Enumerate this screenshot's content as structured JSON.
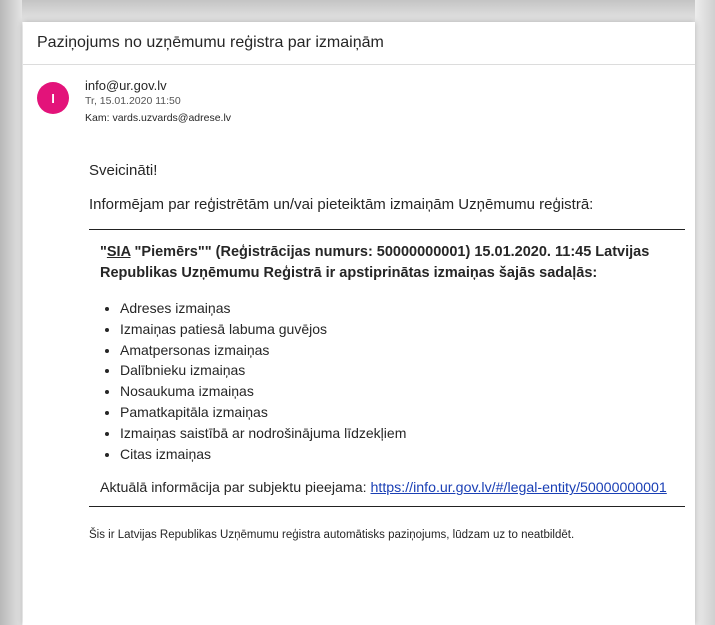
{
  "email": {
    "subject": "Paziņojums no uzņēmumu reģistra par izmaiņām",
    "avatar_initial": "I",
    "avatar_color": "#e3137a",
    "from": "info@ur.gov.lv",
    "date": "Tr, 15.01.2020 11:50",
    "to_label": "Kam:",
    "to": "vards.uzvards@adrese.lv",
    "greeting": "Sveicināti!",
    "intro": "Informējam par reģistrētām un/vai pieteiktām izmaiņām Uzņēmumu reģistrā:",
    "main_open_quote": "\"",
    "main_company_abbr": "SIA",
    "main_company_name": " \"Piemērs\"\"",
    "main_text_rest": " (Reģistrācijas numurs: 50000000001) 15.01.2020. 11:45 Latvijas Republikas Uzņēmumu Reģistrā ir apstiprinātas izmaiņas šajās sadaļās:",
    "changes": [
      "Adreses izmaiņas",
      "Izmaiņas patiesā labuma guvējos",
      "Amatpersonas izmaiņas",
      "Dalībnieku izmaiņas",
      "Nosaukuma izmaiņas",
      "Pamatkapitāla izmaiņas",
      "Izmaiņas saistībā ar nodrošinājuma līdzekļiem",
      "Citas izmaiņas"
    ],
    "info_text": "Aktuālā informācija par subjektu pieejama: ",
    "info_link": "https://info.ur.gov.lv/#/legal-entity/50000000001",
    "footer": "Šis ir Latvijas Republikas Uzņēmumu reģistra automātisks paziņojums, lūdzam uz to neatbildēt."
  }
}
